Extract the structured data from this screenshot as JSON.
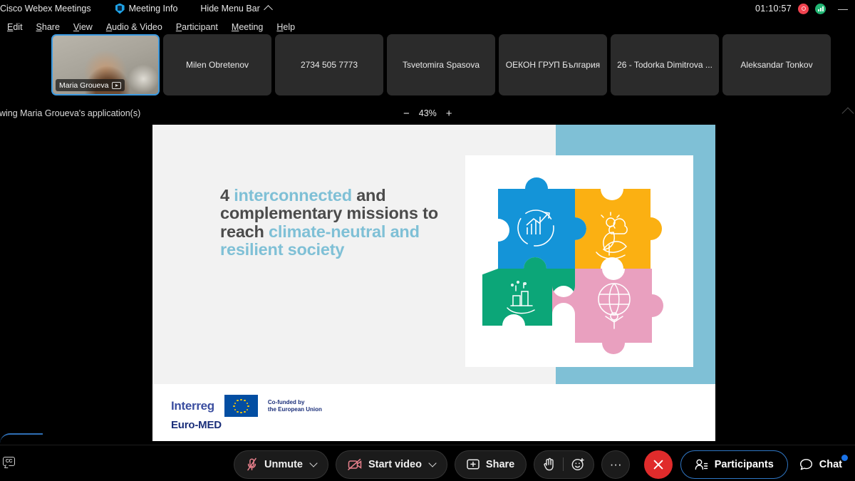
{
  "titlebar": {
    "app_name": "Cisco Webex Meetings",
    "meeting_info": "Meeting Info",
    "hide_menu_bar": "Hide Menu Bar",
    "timer": "01:10:57",
    "minimize": "—",
    "icons": {
      "shield": "shield-icon",
      "recording": "recording-icon",
      "signal": "signal-strength-icon"
    }
  },
  "menubar": {
    "items": [
      {
        "label": "Edit",
        "accel": "E"
      },
      {
        "label": "Share",
        "accel": "S"
      },
      {
        "label": "View",
        "accel": "V"
      },
      {
        "label": "Audio & Video",
        "accel": "A"
      },
      {
        "label": "Participant",
        "accel": "P"
      },
      {
        "label": "Meeting",
        "accel": "M"
      },
      {
        "label": "Help",
        "accel": "H"
      }
    ]
  },
  "filmstrip": {
    "active_tile": {
      "name": "Maria Groueva",
      "badge_icon": "screen-share-icon"
    },
    "tiles": [
      {
        "label": "Milen Obretenov"
      },
      {
        "label": "2734 505 7773"
      },
      {
        "label": "Tsvetomira Spasova"
      },
      {
        "label": "ОЕКОН ГРУП България"
      },
      {
        "label": "26 - Todorka Dimitrova ..."
      },
      {
        "label": "Aleksandar Tonkov"
      }
    ]
  },
  "sharebar": {
    "status": "ewing Maria Groueva's application(s)",
    "zoom_out": "−",
    "zoom_level": "43%",
    "zoom_in": "+"
  },
  "slide": {
    "title_parts": [
      {
        "text": "4 ",
        "accent": false
      },
      {
        "text": "interconnected",
        "accent": true
      },
      {
        "text": " and complementary missions to reach ",
        "accent": false
      },
      {
        "text": "climate-neutral and resilient society",
        "accent": true
      }
    ],
    "title_line1_a": "4 ",
    "title_line1_b": "interconnected",
    "title_line1_c": " and",
    "title_line2": "complementary missions",
    "title_line3_a": "to reach ",
    "title_line3_b": "climate-neutral",
    "title_line4": "and resilient society",
    "puzzle": {
      "pieces": [
        {
          "position": "top-left",
          "color": "#1494d8",
          "icon": "growth-chart-icon"
        },
        {
          "position": "top-right",
          "color": "#fbb012",
          "icon": "plant-sun-icon"
        },
        {
          "position": "bottom-left",
          "color": "#0ca678",
          "icon": "factory-icon"
        },
        {
          "position": "bottom-right",
          "color": "#e9a0bf",
          "icon": "globe-person-icon"
        }
      ]
    },
    "logo": {
      "interreg": "Interreg",
      "programme": "Euro-MED",
      "eu_line1": "Co-funded by",
      "eu_line2": "the European Union",
      "flag_icon": "eu-flag-icon"
    },
    "colors": {
      "accent": "#7fc0d6",
      "background": "#f2f2f2",
      "title_text": "#4b4b4b"
    }
  },
  "controls": {
    "cc_label": "CC",
    "unmute": "Unmute",
    "start_video": "Start video",
    "share": "Share",
    "raise_hand_icon": "raise-hand-icon",
    "reactions_icon": "reactions-icon",
    "more_label": "···",
    "leave_icon": "end-call-icon",
    "participants": "Participants",
    "chat": "Chat",
    "colors": {
      "leave": "#e02b2b",
      "muted": "#e8808c",
      "active_outline": "#2f76c4",
      "notification": "#1a73e8"
    }
  }
}
